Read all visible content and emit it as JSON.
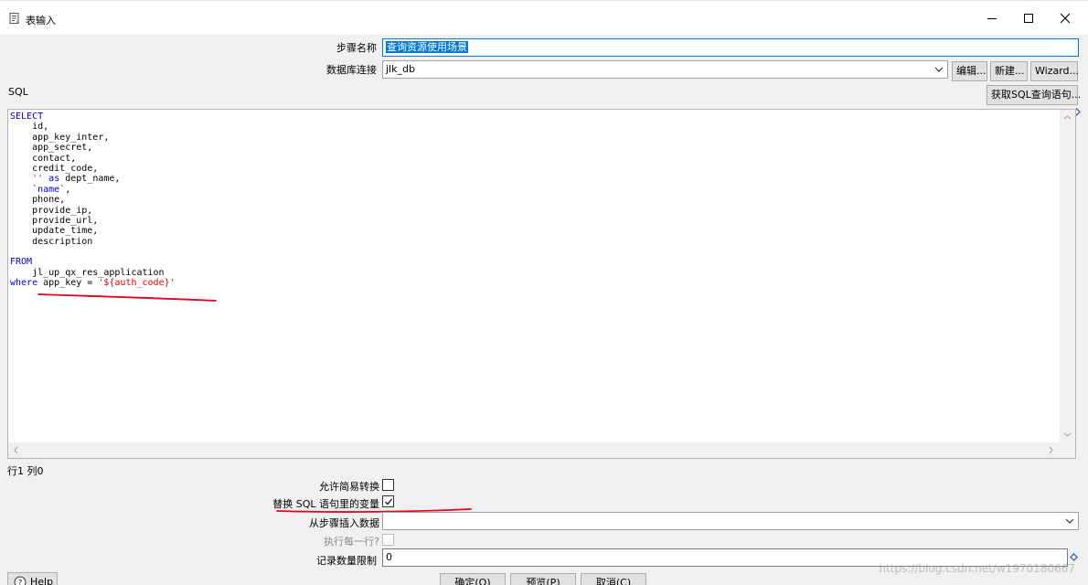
{
  "window": {
    "title": "表输入",
    "title_icon": "document-icon",
    "controls": [
      "minimize-icon",
      "maximize-icon",
      "close-icon"
    ]
  },
  "form": {
    "step_name_label": "步骤名称",
    "step_name_value": "查询资源使用场景",
    "db_conn_label": "数据库连接",
    "db_conn_value": "jlk_db",
    "edit_button": "编辑...",
    "new_button": "新建...",
    "wizard_button": "Wizard...",
    "sql_label": "SQL",
    "get_sql_button": "获取SQL查询语句...",
    "cursor_position": "行1 列0",
    "lazy_conversion_label": "允许简易转换",
    "lazy_conversion_checked": false,
    "replace_vars_label": "替换 SQL 语句里的变量",
    "replace_vars_checked": true,
    "insert_from_step_label": "从步骤插入数据",
    "insert_from_step_value": "",
    "execute_each_row_label": "执行每一行?",
    "execute_each_row_checked": false,
    "limit_label": "记录数量限制",
    "limit_value": "0"
  },
  "sql": {
    "lines": [
      [
        {
          "t": "SELECT",
          "c": "kw"
        }
      ],
      [
        {
          "t": "    id,",
          "c": ""
        }
      ],
      [
        {
          "t": "    app_key_inter,",
          "c": ""
        }
      ],
      [
        {
          "t": "    app_secret,",
          "c": ""
        }
      ],
      [
        {
          "t": "    contact,",
          "c": ""
        }
      ],
      [
        {
          "t": "    credit_code,",
          "c": ""
        }
      ],
      [
        {
          "t": "    ",
          "c": ""
        },
        {
          "t": "''",
          "c": "str"
        },
        {
          "t": " ",
          "c": ""
        },
        {
          "t": "as",
          "c": "kw"
        },
        {
          "t": " dept_name,",
          "c": ""
        }
      ],
      [
        {
          "t": "    ",
          "c": ""
        },
        {
          "t": "`name`",
          "c": "kw"
        },
        {
          "t": ",",
          "c": ""
        }
      ],
      [
        {
          "t": "    phone,",
          "c": ""
        }
      ],
      [
        {
          "t": "    provide_ip,",
          "c": ""
        }
      ],
      [
        {
          "t": "    provide_url,",
          "c": ""
        }
      ],
      [
        {
          "t": "    update_time,",
          "c": ""
        }
      ],
      [
        {
          "t": "    description",
          "c": ""
        }
      ],
      [
        {
          "t": "",
          "c": ""
        }
      ],
      [
        {
          "t": "FROM",
          "c": "kw"
        }
      ],
      [
        {
          "t": "    jl_up_qx_res_application",
          "c": ""
        }
      ],
      [
        {
          "t": "where",
          "c": "kw"
        },
        {
          "t": " app_key = ",
          "c": ""
        },
        {
          "t": "'${auth_code}'",
          "c": "str"
        }
      ]
    ]
  },
  "buttons": {
    "help": "Help",
    "ok": "确定(O)",
    "preview": "预览(P)",
    "cancel": "取消(C)"
  },
  "watermark": "https://blog.csdn.net/w1970180667",
  "colors": {
    "keyword": "#0000cc",
    "string": "#e00000",
    "annotation_red": "#e8001c",
    "selection": "#0078d7",
    "dialog_bg": "#f0f0f0"
  }
}
